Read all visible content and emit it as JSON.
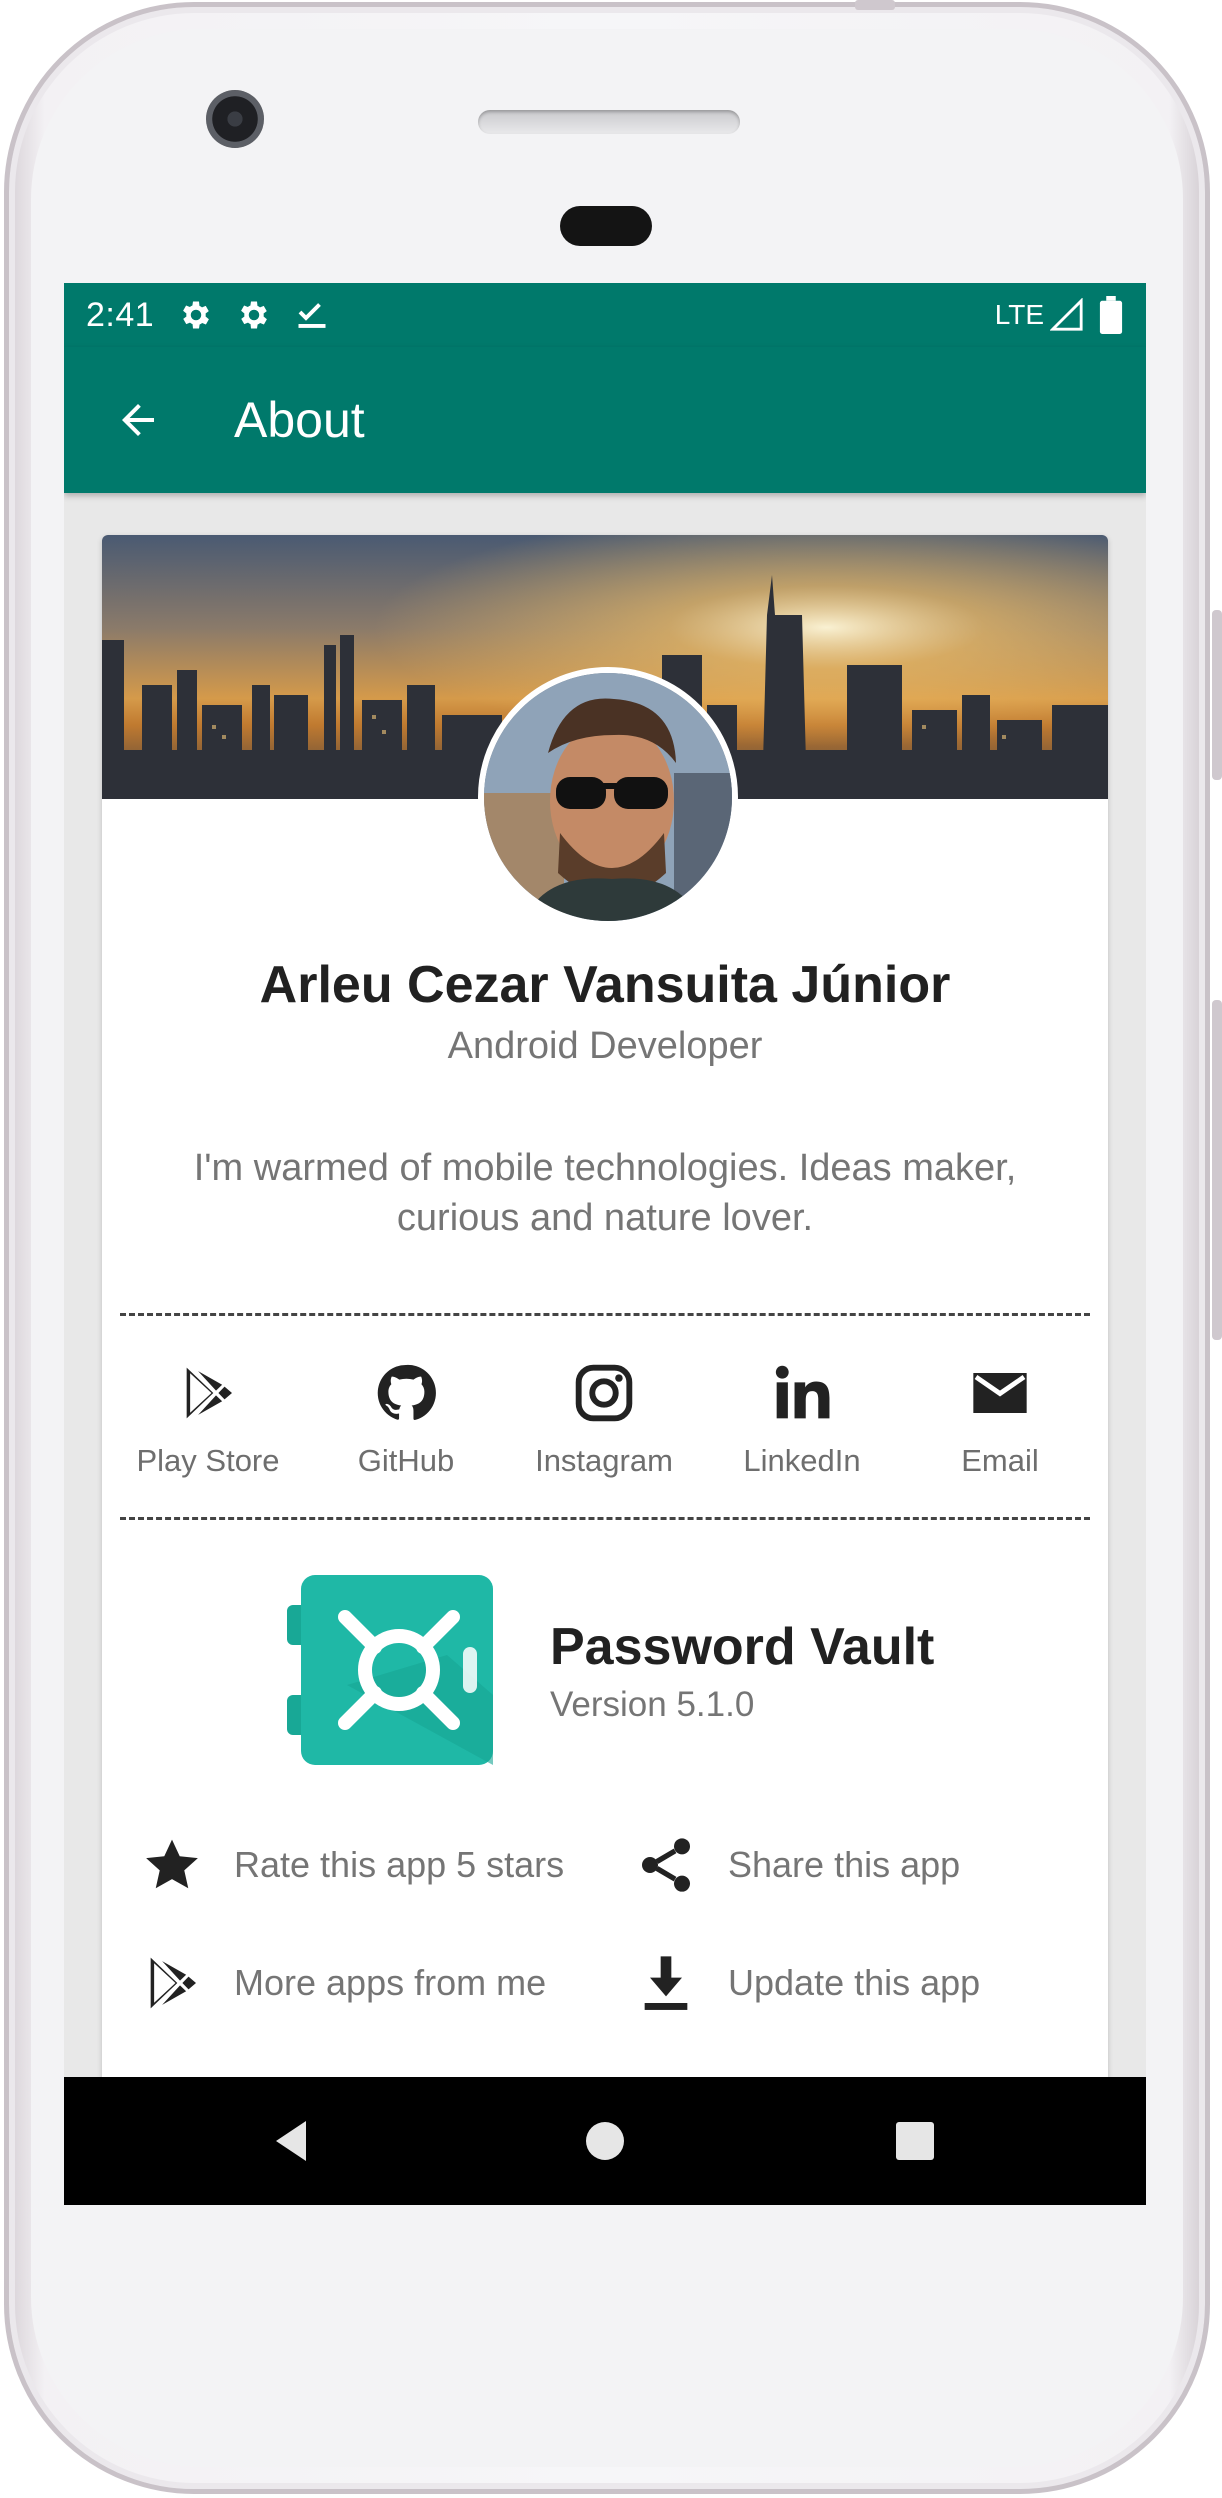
{
  "status_bar": {
    "time": "2:41",
    "network": "LTE",
    "icons": [
      "settings-icon",
      "settings-icon",
      "task-done-icon",
      "signal-icon",
      "battery-icon"
    ]
  },
  "app_bar": {
    "title": "About",
    "back_icon": "arrow-back-icon",
    "color": "#00796b"
  },
  "profile": {
    "name": "Arleu Cezar Vansuita Júnior",
    "role": "Android Developer",
    "bio": "I'm warmed of mobile technologies. Ideas maker, curious and nature lover."
  },
  "socials": [
    {
      "label": "Play Store",
      "icon": "play-store-icon"
    },
    {
      "label": "GitHub",
      "icon": "github-icon"
    },
    {
      "label": "Instagram",
      "icon": "instagram-icon"
    },
    {
      "label": "LinkedIn",
      "icon": "linkedin-icon"
    },
    {
      "label": "Email",
      "icon": "email-icon"
    }
  ],
  "app": {
    "name": "Password Vault",
    "version": "Version 5.1.0",
    "logo_color": "#1fb8a6"
  },
  "actions": [
    {
      "label": "Rate this app 5 stars",
      "icon": "star-icon"
    },
    {
      "label": "Share this app",
      "icon": "share-icon"
    },
    {
      "label": "More apps from me",
      "icon": "play-store-icon"
    },
    {
      "label": "Update this app",
      "icon": "download-icon"
    }
  ],
  "nav_bar": {
    "buttons": [
      "back-triangle-icon",
      "home-circle-icon",
      "recents-square-icon"
    ]
  }
}
